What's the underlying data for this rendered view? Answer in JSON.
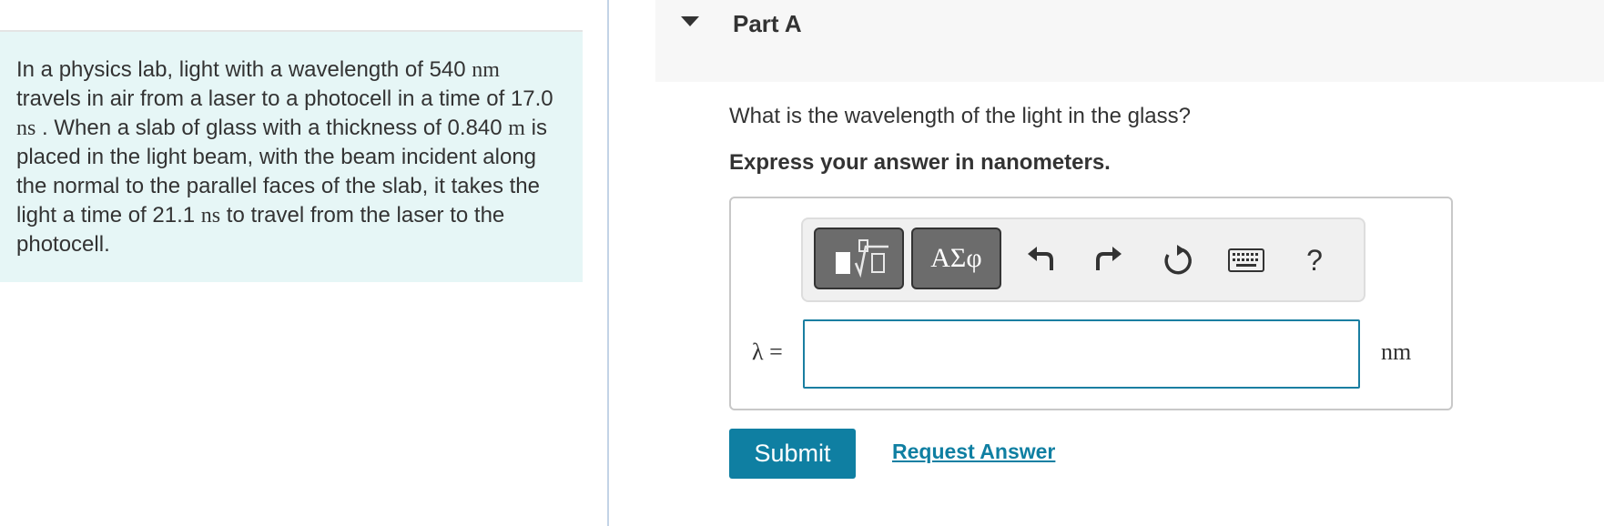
{
  "problem": {
    "t1": "In a physics lab, light with a wavelength of 540 ",
    "u1": "nm",
    "t2": " travels in air from a laser to a photocell in a time of 17.0 ",
    "u2": "ns",
    "t3": " . When a slab of glass with a thickness of 0.840 ",
    "u3": "m",
    "t4": " is placed in the light beam, with the beam incident along the normal to the parallel faces of the slab, it takes the light a time of 21.1 ",
    "u4": "ns",
    "t5": " to travel from the laser to the photocell."
  },
  "part": {
    "title": "Part A"
  },
  "question": "What is the wavelength of the light in the glass?",
  "instruction": "Express your answer in nanometers.",
  "toolbar": {
    "greek_label": "ΑΣφ",
    "help_label": "?",
    "icons": [
      "templates-icon",
      "greek-letters-icon",
      "undo-icon",
      "redo-icon",
      "reset-icon",
      "keyboard-icon",
      "help-icon"
    ]
  },
  "answer": {
    "variable_label": "λ =",
    "value": "",
    "unit": "nm"
  },
  "buttons": {
    "submit": "Submit",
    "request_answer": "Request Answer"
  },
  "colors": {
    "accent": "#0f7fa2",
    "problem_bg": "#e6f6f6",
    "header_bg": "#f7f7f7"
  }
}
